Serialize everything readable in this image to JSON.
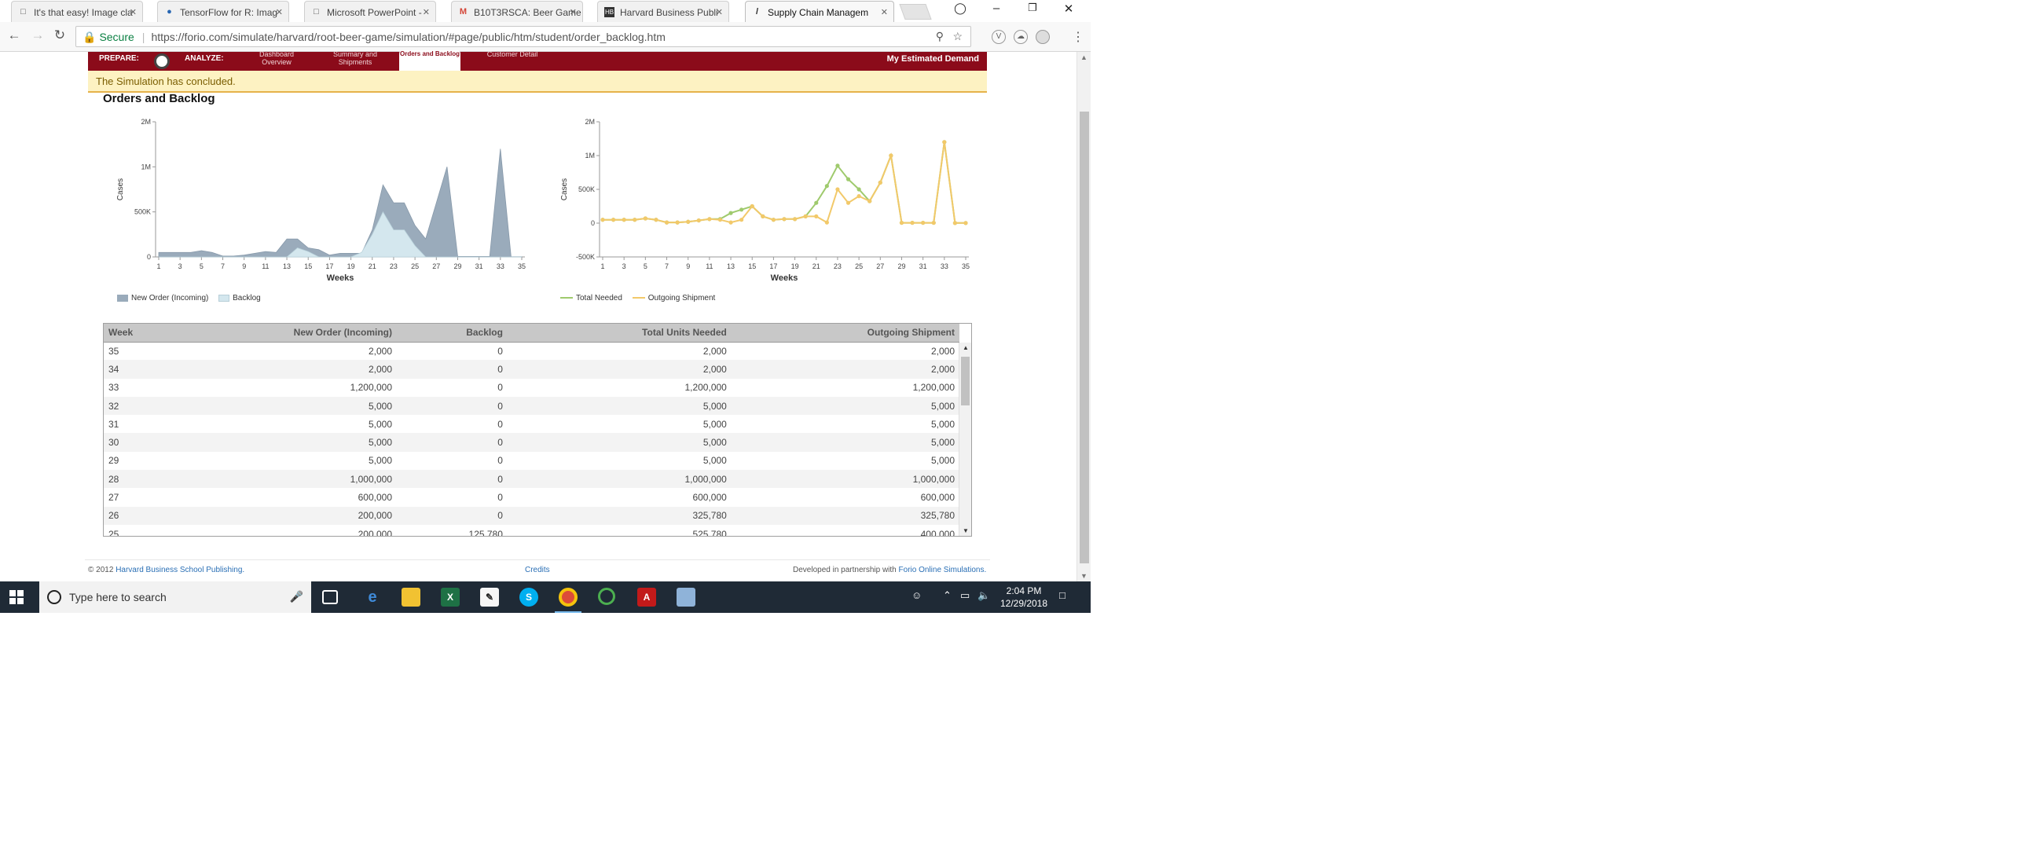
{
  "browser": {
    "tabs": [
      {
        "title": "It's that easy! Image cla",
        "icon": "doc-icon"
      },
      {
        "title": "TensorFlow for R: Imag",
        "icon": "r-icon"
      },
      {
        "title": "Microsoft PowerPoint -",
        "icon": "doc-icon"
      },
      {
        "title": "B10T3RSCA: Beer Game",
        "icon": "gmail-icon"
      },
      {
        "title": "Harvard Business Publi",
        "icon": "hb-icon"
      },
      {
        "title": "Supply Chain Managem",
        "icon": "forio-icon"
      }
    ],
    "secure_label": "Secure",
    "url": "https://forio.com/simulate/harvard/root-beer-game/simulation/#page/public/htm/student/order_backlog.htm"
  },
  "nav": {
    "prepare": "PREPARE:",
    "analyze": "ANALYZE:",
    "items": [
      "Dashboard Overview",
      "Summary and Shipments",
      "Orders and Backlog",
      "Customer Detail"
    ],
    "right": "My Estimated Demand"
  },
  "notice": "The Simulation has concluded.",
  "section_title": "Orders and Backlog",
  "charts": {
    "left_ylabel": "Cases",
    "right_ylabel": "Cases",
    "left_xlabel": "Weeks",
    "right_xlabel": "Weeks",
    "left_legend": [
      "New Order (Incoming)",
      "Backlog"
    ],
    "right_legend": [
      "Total Needed",
      "Outgoing Shipment"
    ],
    "colors": {
      "new_order": "#9aabbb",
      "backlog": "#d4e7ee",
      "total_needed": "#9fca6d",
      "outgoing": "#f2c96a"
    }
  },
  "chart_data": [
    {
      "type": "area",
      "xlabel": "Weeks",
      "ylabel": "Cases",
      "x_ticks": [
        "1",
        "3",
        "5",
        "7",
        "9",
        "11",
        "13",
        "15",
        "17",
        "19",
        "21",
        "23",
        "25",
        "27",
        "29",
        "31",
        "33",
        "35"
      ],
      "y_ticks": [
        "0",
        "500K",
        "1M",
        "2M"
      ],
      "ylim": [
        0,
        1500000
      ],
      "x": [
        1,
        2,
        3,
        4,
        5,
        6,
        7,
        8,
        9,
        10,
        11,
        12,
        13,
        14,
        15,
        16,
        17,
        18,
        19,
        20,
        21,
        22,
        23,
        24,
        25,
        26,
        27,
        28,
        29,
        30,
        31,
        32,
        33,
        34,
        35
      ],
      "series": [
        {
          "name": "New Order (Incoming)",
          "values": [
            50000,
            50000,
            50000,
            50000,
            70000,
            50000,
            10000,
            10000,
            20000,
            40000,
            60000,
            50000,
            200000,
            200000,
            100000,
            80000,
            20000,
            40000,
            40000,
            40000,
            300000,
            800000,
            600000,
            600000,
            350000,
            200000,
            600000,
            1000000,
            5000,
            5000,
            5000,
            5000,
            1200000,
            2000,
            2000
          ]
        },
        {
          "name": "Backlog",
          "values": [
            0,
            0,
            0,
            0,
            0,
            0,
            0,
            0,
            0,
            0,
            0,
            0,
            0,
            100000,
            60000,
            0,
            0,
            0,
            0,
            50000,
            250000,
            500000,
            300000,
            300000,
            125780,
            0,
            0,
            0,
            0,
            0,
            0,
            0,
            0,
            0,
            0
          ]
        }
      ]
    },
    {
      "type": "line",
      "xlabel": "Weeks",
      "ylabel": "Cases",
      "x_ticks": [
        "1",
        "3",
        "5",
        "7",
        "9",
        "11",
        "13",
        "15",
        "17",
        "19",
        "21",
        "23",
        "25",
        "27",
        "29",
        "31",
        "33",
        "35"
      ],
      "y_ticks": [
        "-500K",
        "0",
        "500K",
        "1M",
        "2M"
      ],
      "ylim": [
        -500000,
        1500000
      ],
      "x": [
        1,
        2,
        3,
        4,
        5,
        6,
        7,
        8,
        9,
        10,
        11,
        12,
        13,
        14,
        15,
        16,
        17,
        18,
        19,
        20,
        21,
        22,
        23,
        24,
        25,
        26,
        27,
        28,
        29,
        30,
        31,
        32,
        33,
        34,
        35
      ],
      "series": [
        {
          "name": "Total Needed",
          "values": [
            50000,
            50000,
            50000,
            50000,
            70000,
            50000,
            10000,
            10000,
            20000,
            40000,
            60000,
            60000,
            150000,
            200000,
            250000,
            100000,
            50000,
            60000,
            60000,
            100000,
            300000,
            550000,
            850000,
            650000,
            500000,
            325780,
            600000,
            1000000,
            5000,
            5000,
            5000,
            5000,
            1200000,
            2000,
            2000
          ]
        },
        {
          "name": "Outgoing Shipment",
          "values": [
            50000,
            50000,
            50000,
            50000,
            70000,
            50000,
            10000,
            10000,
            20000,
            40000,
            60000,
            50000,
            10000,
            50000,
            250000,
            100000,
            50000,
            60000,
            60000,
            100000,
            100000,
            10000,
            500000,
            300000,
            400000,
            325780,
            600000,
            1000000,
            5000,
            5000,
            5000,
            5000,
            1200000,
            2000,
            2000
          ]
        }
      ]
    }
  ],
  "table": {
    "headers": [
      "Week",
      "New Order (Incoming)",
      "Backlog",
      "Total Units Needed",
      "Outgoing Shipment"
    ],
    "rows": [
      [
        "35",
        "2,000",
        "0",
        "2,000",
        "2,000"
      ],
      [
        "34",
        "2,000",
        "0",
        "2,000",
        "2,000"
      ],
      [
        "33",
        "1,200,000",
        "0",
        "1,200,000",
        "1,200,000"
      ],
      [
        "32",
        "5,000",
        "0",
        "5,000",
        "5,000"
      ],
      [
        "31",
        "5,000",
        "0",
        "5,000",
        "5,000"
      ],
      [
        "30",
        "5,000",
        "0",
        "5,000",
        "5,000"
      ],
      [
        "29",
        "5,000",
        "0",
        "5,000",
        "5,000"
      ],
      [
        "28",
        "1,000,000",
        "0",
        "1,000,000",
        "1,000,000"
      ],
      [
        "27",
        "600,000",
        "0",
        "600,000",
        "600,000"
      ],
      [
        "26",
        "200,000",
        "0",
        "325,780",
        "325,780"
      ],
      [
        "25",
        "200,000",
        "125,780",
        "525,780",
        "400,000"
      ]
    ]
  },
  "footer": {
    "copyright": "© 2012",
    "publisher": "Harvard Business School Publishing.",
    "credits": "Credits",
    "developed": "Developed in partnership with",
    "partner": "Forio Online Simulations."
  },
  "taskbar": {
    "search_placeholder": "Type here to search",
    "time": "2:04 PM",
    "date": "12/29/2018"
  }
}
